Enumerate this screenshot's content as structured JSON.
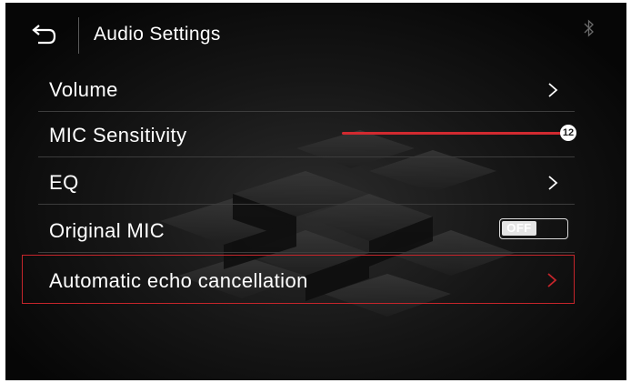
{
  "header": {
    "title": "Audio Settings",
    "back_icon": "back-arrow-icon",
    "status_icon": "bluetooth-icon"
  },
  "rows": [
    {
      "label": "Volume",
      "control": "chevron"
    },
    {
      "label": "MIC Sensitivity",
      "control": "slider",
      "value_label": "12",
      "value": 12
    },
    {
      "label": "EQ",
      "control": "chevron"
    },
    {
      "label": "Original MIC",
      "control": "toggle",
      "toggle_label": "OFF",
      "enabled": false
    },
    {
      "label": "Automatic echo cancellation",
      "control": "chevron",
      "selected": true
    }
  ],
  "colors": {
    "accent": "#d12a30",
    "selected_border": "#c4252b",
    "text": "#ffffff",
    "divider": "#3c3c3c"
  }
}
